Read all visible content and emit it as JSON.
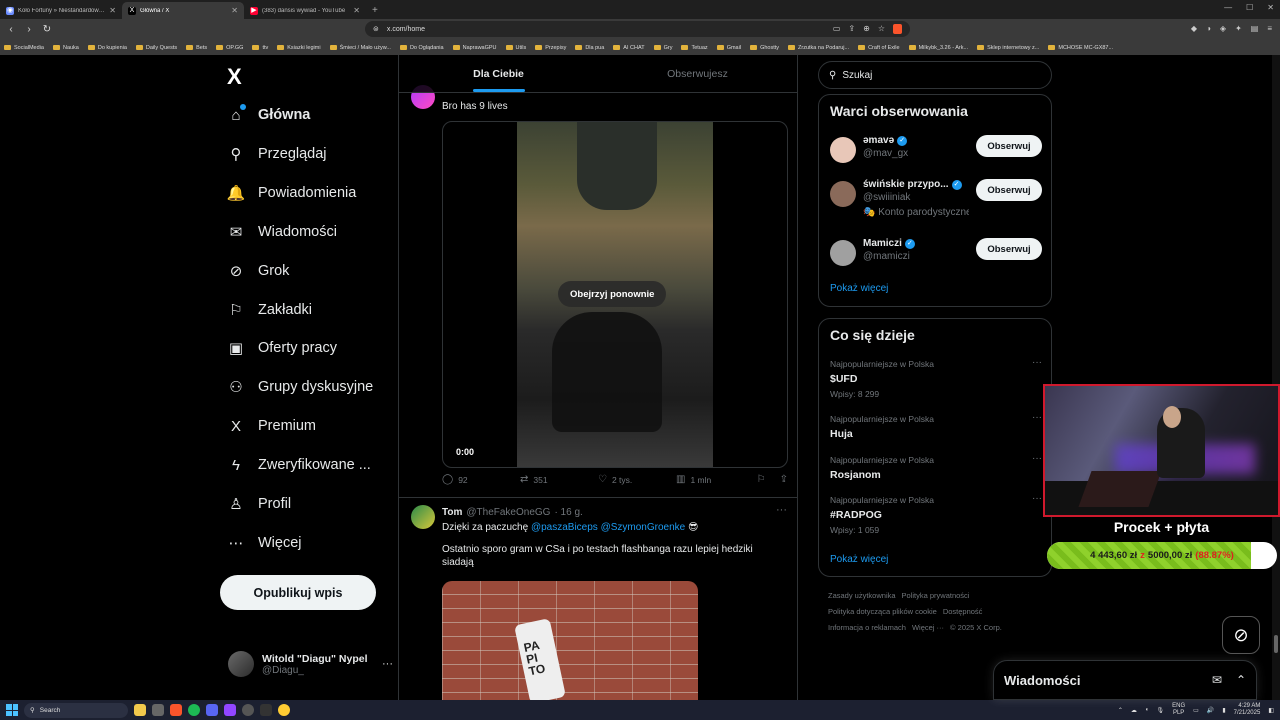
{
  "browser": {
    "tabs": [
      {
        "title": "Koło Fortuny » Niestandardowy Wyn",
        "color": "#6a8cff",
        "glyph": "◉"
      },
      {
        "title": "Główna / X",
        "color": "#000000",
        "glyph": "X"
      },
      {
        "title": "(383) dansis wywiad - YouTube",
        "color": "#ff0033",
        "glyph": "▶"
      }
    ],
    "new_tab": "+",
    "url": "x.com/home",
    "bookmarks": [
      "SocialMedia",
      "Nauka",
      "Do kupienia",
      "Daily Quests",
      "Bets",
      "OP.GG",
      "ttv",
      "Ksiazki legimi",
      "Śmieci / Mało używ...",
      "Do Oglądania",
      "NaprawaGPU",
      "Utils",
      "Przepisy",
      "Dla pua",
      "AI CHAT",
      "Gry",
      "Tetuaz",
      "Gmail",
      "Ghostty",
      "Zrzutka na Podaruj...",
      "Craft of Exile",
      "Milkybk_3.26 - Ark...",
      "Sklep internetowy z...",
      "MCHOSE MC-GX87..."
    ]
  },
  "nav": {
    "logo": "X",
    "items": [
      {
        "label": "Główna",
        "icon": "home-icon",
        "glyph": "⌂"
      },
      {
        "label": "Przeglądaj",
        "icon": "search-icon",
        "glyph": "⚲"
      },
      {
        "label": "Powiadomienia",
        "icon": "bell-icon",
        "glyph": "🔔"
      },
      {
        "label": "Wiadomości",
        "icon": "mail-icon",
        "glyph": "✉"
      },
      {
        "label": "Grok",
        "icon": "grok-icon",
        "glyph": "⊘"
      },
      {
        "label": "Zakładki",
        "icon": "bookmark-icon",
        "glyph": "⚐"
      },
      {
        "label": "Oferty pracy",
        "icon": "briefcase-icon",
        "glyph": "▣"
      },
      {
        "label": "Grupy dyskusyjne",
        "icon": "people-icon",
        "glyph": "⚇"
      },
      {
        "label": "Premium",
        "icon": "x-premium-icon",
        "glyph": "X"
      },
      {
        "label": "Zweryfikowane ...",
        "icon": "lightning-icon",
        "glyph": "ϟ"
      },
      {
        "label": "Profil",
        "icon": "person-icon",
        "glyph": "♙"
      },
      {
        "label": "Więcej",
        "icon": "more-circle-icon",
        "glyph": "⋯"
      }
    ],
    "post_button": "Opublikuj wpis",
    "me": {
      "name": "Witold \"Diagu\" Nypel",
      "handle": "@Diagu_",
      "more": "···"
    }
  },
  "feed": {
    "tabs": [
      "Dla Ciebie",
      "Obserwujesz"
    ],
    "tweet1": {
      "text": "Bro has 9 lives",
      "replay": "Obejrzyj ponownie",
      "time": "0:00",
      "replies": "92",
      "reposts": "351",
      "likes": "2 tys.",
      "views": "1 mln"
    },
    "tweet2": {
      "name": "Tom",
      "handle": "@TheFakeOneGG",
      "time": "· 16 g.",
      "more": "···",
      "line1_prefix": "Dzięki za paczuchę ",
      "mention1": "@paszaBiceps",
      "mention2": "@SzymonGroenke",
      "emoji": "😎",
      "line2": "Ostatnio sporo gram w CSa i po testach  flashbanga razu lepiej hedziki siadają",
      "can_label": "PA PI TO"
    }
  },
  "right": {
    "search_placeholder": "Szukaj",
    "who_title": "Warci obserwowania",
    "who": [
      {
        "name": "əmavə",
        "handle": "@mav_gx",
        "badge": "",
        "follow": "Obserwuj",
        "color": "#e8c7b8"
      },
      {
        "name": "świńskie przypo...",
        "handle": "@swiiiniak",
        "badge": "🎭 Konto parodystyczne",
        "follow": "Obserwuj",
        "color": "#8a6a5a"
      },
      {
        "name": "Mamiczi",
        "handle": "@mamiczi",
        "badge": "",
        "follow": "Obserwuj",
        "color": "#a0a0a0"
      }
    ],
    "who_more": "Pokaż więcej",
    "trends_title": "Co się dzieje",
    "trends": [
      {
        "category": "Najpopularniejsze w Polska",
        "name": "$UFD",
        "count": "Wpisy: 8 299"
      },
      {
        "category": "Najpopularniejsze w Polska",
        "name": "Huja",
        "count": ""
      },
      {
        "category": "Najpopularniejsze w Polska",
        "name": "Rosjanom",
        "count": ""
      },
      {
        "category": "Najpopularniejsze w Polska",
        "name": "#RADPOG",
        "count": "Wpisy: 1 059"
      }
    ],
    "trends_more": "Pokaż więcej",
    "footer": [
      "Zasady użytkownika",
      "Polityka prywatności",
      "Polityka dotycząca plików cookie",
      "Dostępność",
      "Informacja o reklamach",
      "Więcej ···",
      "© 2025 X Corp."
    ]
  },
  "messages": {
    "title": "Wiadomości"
  },
  "overlay": {
    "goal_title": "Procek + płyta",
    "current": "4 443,60 zł",
    "separator": "z",
    "target": "5000,00 zł",
    "percent": "(88.87%)",
    "progress": 0.8887
  },
  "taskbar": {
    "search": "Search",
    "lang": "ENG",
    "lang_sub": "PLP",
    "time": "4:29 AM",
    "date": "7/21/2025"
  }
}
